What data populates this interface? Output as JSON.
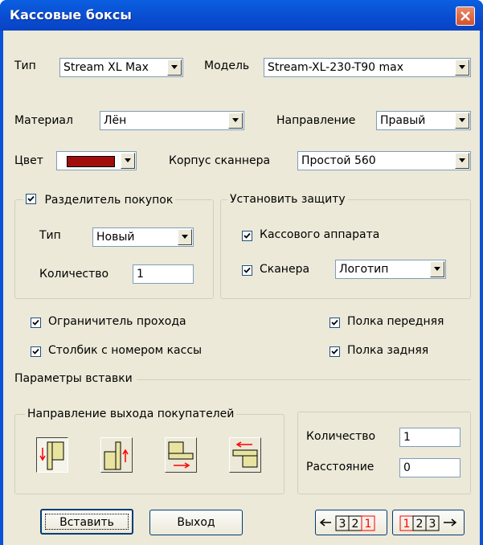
{
  "window": {
    "title": "Кассовые боксы"
  },
  "row1": {
    "type_label": "Тип",
    "type_value": "Stream XL Max",
    "model_label": "Модель",
    "model_value": "Stream-XL-230-T90 max"
  },
  "row2": {
    "material_label": "Материал",
    "material_value": "Лён",
    "direction_label": "Направление",
    "direction_value": "Правый"
  },
  "row3": {
    "color_label": "Цвет",
    "color_value": "#a00d0a",
    "scanner_label": "Корпус сканнера",
    "scanner_value": "Простой 560"
  },
  "divider": {
    "label": "Разделитель покупок",
    "checked": true,
    "type_label": "Тип",
    "type_value": "Новый",
    "qty_label": "Количество",
    "qty_value": "1"
  },
  "protection": {
    "label": "Установить защиту",
    "cash_label": "Кассового аппарата",
    "cash_checked": true,
    "scanner_label": "Сканера",
    "scanner_checked": true,
    "scanner_value": "Логотип"
  },
  "options": {
    "limiter": "Ограничитель прохода",
    "post": "Столбик с номером кассы",
    "front": "Полка передняя",
    "back": "Полка задняя"
  },
  "insert": {
    "label": "Параметры вставки",
    "exit_label": "Направление выхода покупателей",
    "qty_label": "Количество",
    "qty_value": "1",
    "dist_label": "Расстояние",
    "dist_value": "0"
  },
  "buttons": {
    "insert": "Вставить",
    "exit": "Выход"
  },
  "order": {
    "left_digits": [
      "3",
      "2",
      "1"
    ],
    "right_digits": [
      "1",
      "2",
      "3"
    ]
  },
  "colors": {
    "accent_red": "#ff0000",
    "shape_fill": "#e8e4a0"
  }
}
